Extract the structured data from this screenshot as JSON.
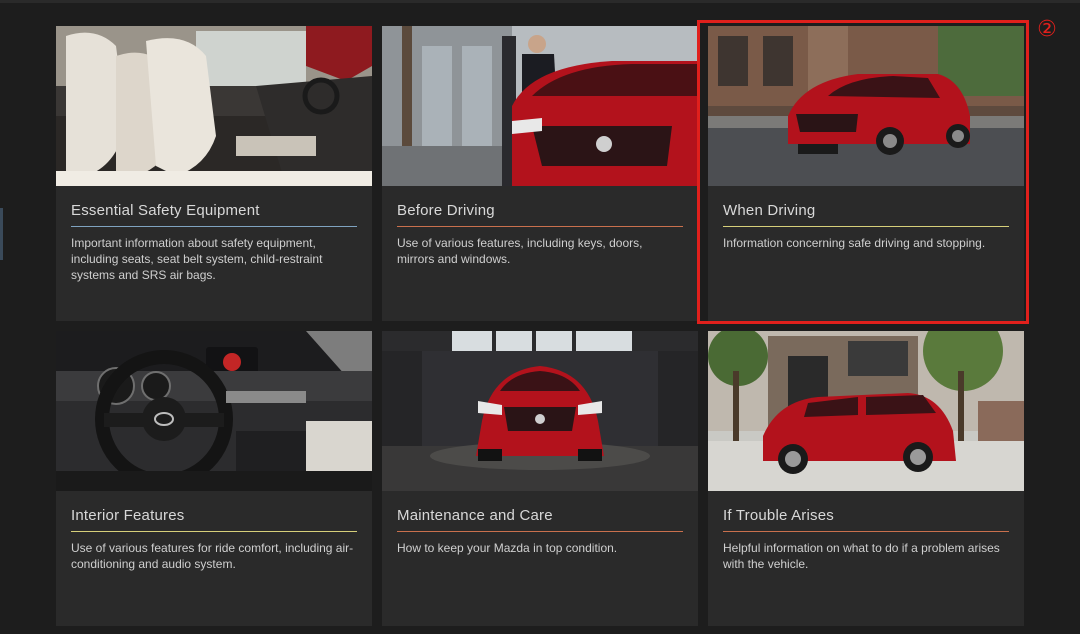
{
  "colors": {
    "background": "#1d1d1d",
    "card": "#2a2a2a",
    "highlight": "#e0201c",
    "rule_blue": "#7fa3c0",
    "rule_yellow": "#d6cf7a",
    "rule_red": "#c9704d",
    "car_red": "#b3121c"
  },
  "annotation": {
    "marker": "②"
  },
  "cards": [
    {
      "title": "Essential Safety Equipment",
      "description": "Important information about safety equipment, including seats, seat belt system, child-restraint systems and SRS air bags.",
      "image": "car-interior-seats-image"
    },
    {
      "title": "Before Driving",
      "description": "Use of various features, including keys, doors, mirrors and windows.",
      "image": "man-opening-car-door-image"
    },
    {
      "title": "When Driving",
      "description": "Information concerning safe driving and stopping.",
      "image": "car-driving-on-street-image"
    },
    {
      "title": "Interior Features",
      "description": "Use of various features for ride comfort, including air-conditioning and audio system.",
      "image": "steering-wheel-dashboard-image"
    },
    {
      "title": "Maintenance and Care",
      "description": "How to keep your Mazda in top condition.",
      "image": "car-in-garage-image"
    },
    {
      "title": "If Trouble Arises",
      "description": "Helpful information on what to do if a problem arises with the vehicle.",
      "image": "car-parked-by-house-image"
    }
  ]
}
